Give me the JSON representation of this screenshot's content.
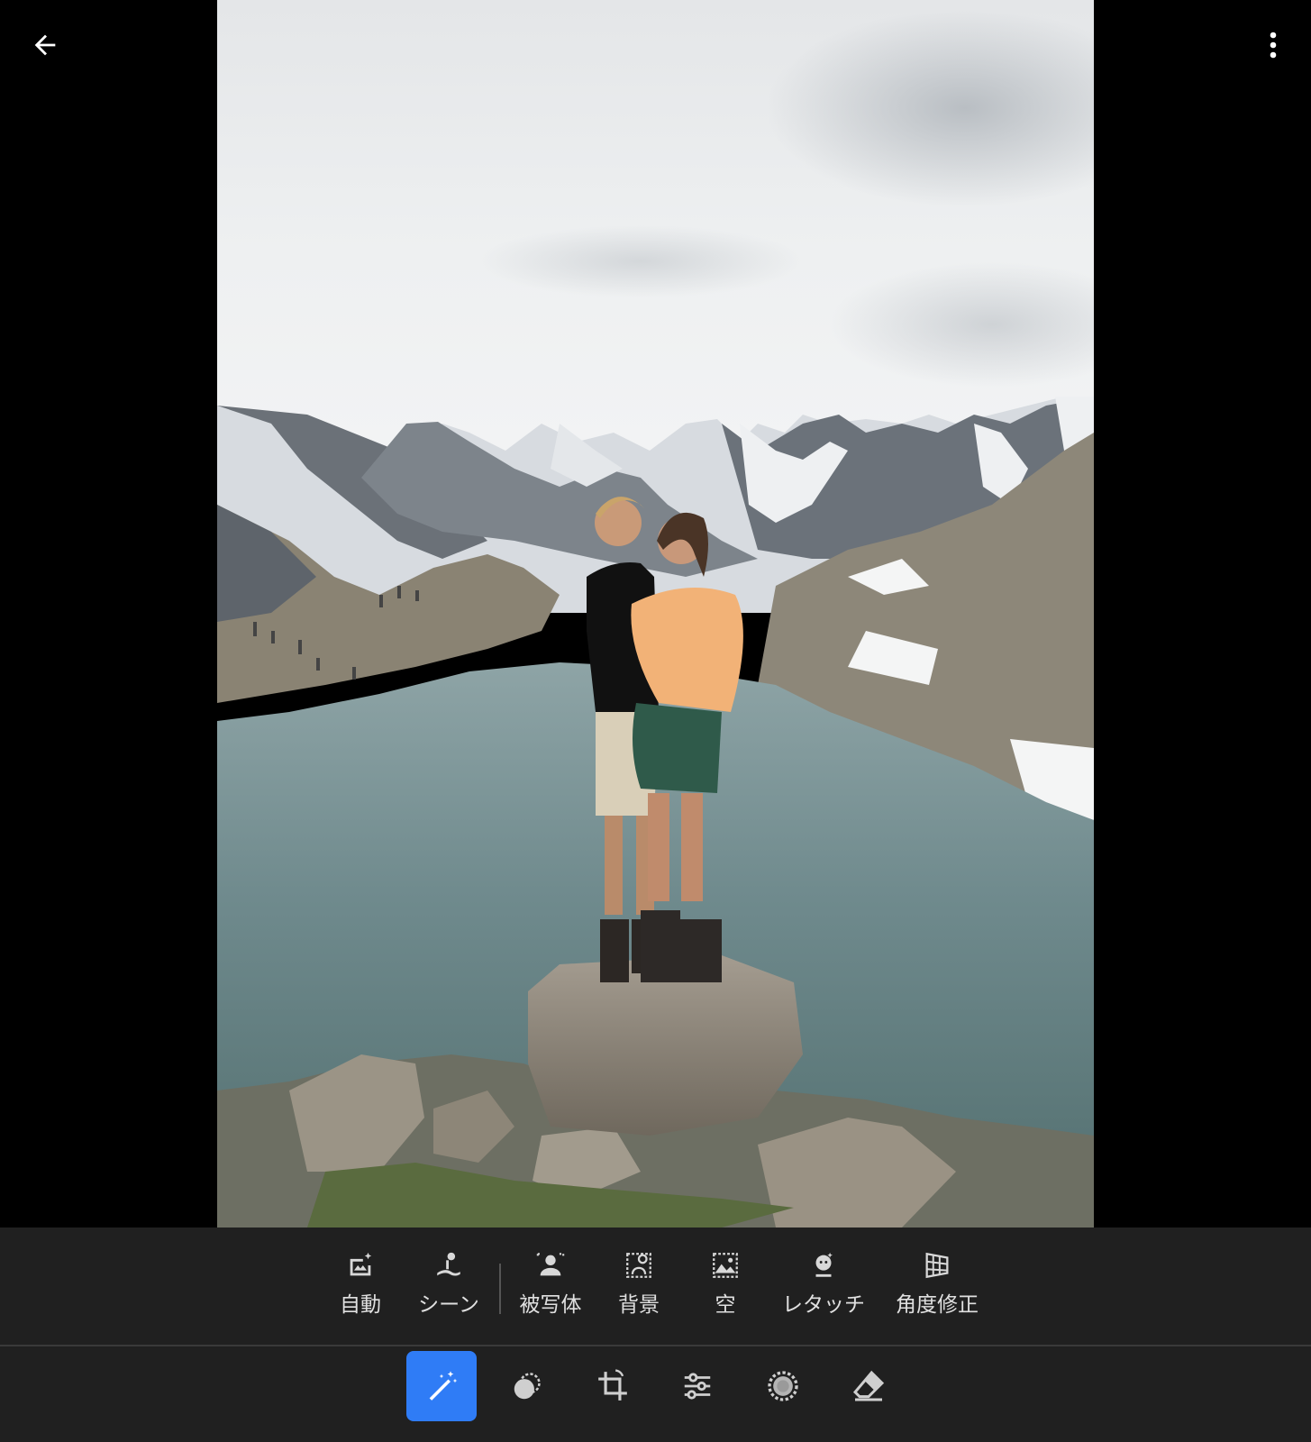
{
  "toolbar": {
    "back_icon": "arrow-back-icon",
    "more_icon": "more-vertical-icon"
  },
  "presets": {
    "items": [
      {
        "label": "自動",
        "icon": "auto-enhance-icon"
      },
      {
        "label": "シーン",
        "icon": "scene-icon"
      },
      {
        "label": "被写体",
        "icon": "subject-icon"
      },
      {
        "label": "背景",
        "icon": "background-icon"
      },
      {
        "label": "空",
        "icon": "sky-icon"
      },
      {
        "label": "レタッチ",
        "icon": "retouch-icon"
      },
      {
        "label": "角度修正",
        "icon": "perspective-icon"
      }
    ]
  },
  "tools": {
    "items": [
      {
        "icon": "magic-wand-icon",
        "active": true
      },
      {
        "icon": "mask-icon",
        "active": false
      },
      {
        "icon": "crop-rotate-icon",
        "active": false
      },
      {
        "icon": "adjust-sliders-icon",
        "active": false
      },
      {
        "icon": "vignette-icon",
        "active": false
      },
      {
        "icon": "eraser-icon",
        "active": false
      }
    ]
  },
  "colors": {
    "accent": "#2f7cf6",
    "panel": "#202020",
    "background": "#000000"
  }
}
